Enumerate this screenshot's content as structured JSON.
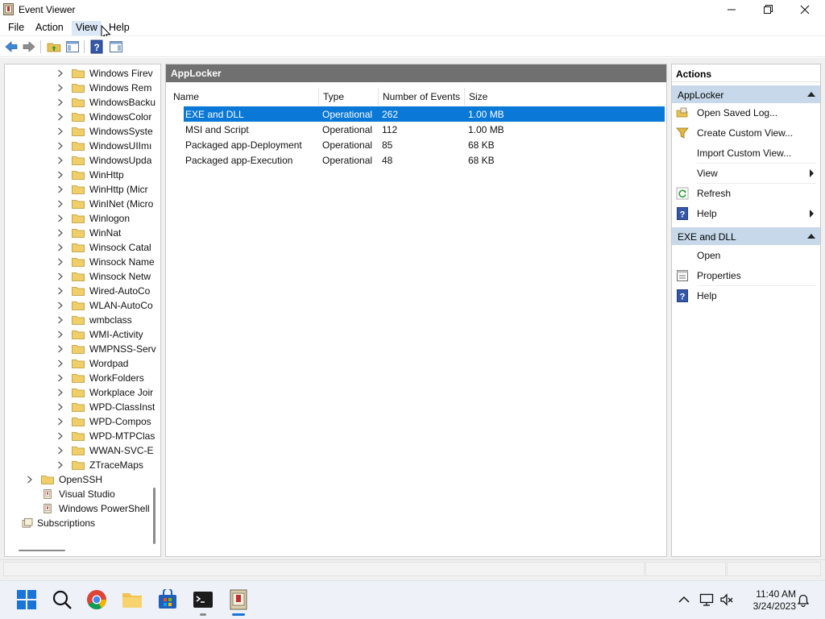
{
  "window": {
    "title": "Event Viewer",
    "icon": "event-viewer-icon"
  },
  "menu": {
    "items": [
      "File",
      "Action",
      "View",
      "Help"
    ],
    "active": "View"
  },
  "toolbar": {
    "buttons": [
      "back-icon",
      "forward-icon",
      "up-folder-icon",
      "show-hide-tree-icon",
      "help-icon",
      "show-hide-action-pane-icon"
    ]
  },
  "tree": {
    "items": [
      "Windows Firev",
      "Windows Rem",
      "WindowsBacku",
      "WindowsColor",
      "WindowsSyste",
      "WindowsUIImı",
      "WindowsUpda",
      "WinHttp",
      "WinHttp (Micr",
      "WinINet (Micro",
      "Winlogon",
      "WinNat",
      "Winsock Catal",
      "Winsock Namе",
      "Winsock Netw",
      "Wired-AutoCo",
      "WLAN-AutoCo",
      "wmbclass",
      "WMI-Activity",
      "WMPNSS-Serv",
      "Wordpad",
      "WorkFolders",
      "Workplace Joir",
      "WPD-ClassInst",
      "WPD-Compos",
      "WPD-MTPClas",
      "WWAN-SVC-E",
      "ZTraceMaps"
    ],
    "root_items": [
      {
        "label": "OpenSSH",
        "expandable": true,
        "icon": "folder-icon"
      },
      {
        "label": "Visual Studio",
        "expandable": false,
        "icon": "log-icon"
      },
      {
        "label": "Windows PowerShell",
        "expandable": false,
        "icon": "log-icon"
      }
    ],
    "subscriptions": "Subscriptions"
  },
  "center": {
    "header": "AppLocker",
    "columns": [
      "Name",
      "Type",
      "Number of Events",
      "Size"
    ],
    "rows": [
      {
        "name": "EXE and DLL",
        "type": "Operational",
        "events": "262",
        "size": "1.00 MB",
        "selected": true
      },
      {
        "name": "MSI and Script",
        "type": "Operational",
        "events": "112",
        "size": "1.00 MB",
        "selected": false
      },
      {
        "name": "Packaged app-Deployment",
        "type": "Operational",
        "events": "85",
        "size": "68 KB",
        "selected": false
      },
      {
        "name": "Packaged app-Execution",
        "type": "Operational",
        "events": "48",
        "size": "68 KB",
        "selected": false
      }
    ]
  },
  "actions": {
    "title": "Actions",
    "section1": {
      "label": "AppLocker",
      "items": [
        {
          "label": "Open Saved Log...",
          "icon": "open-log-icon",
          "submenu": false
        },
        {
          "label": "Create Custom View...",
          "icon": "filter-icon",
          "submenu": false
        },
        {
          "label": "Import Custom View...",
          "icon": "",
          "submenu": false
        },
        {
          "label": "View",
          "icon": "",
          "submenu": true
        },
        {
          "label": "Refresh",
          "icon": "refresh-icon",
          "submenu": false
        },
        {
          "label": "Help",
          "icon": "help-icon",
          "submenu": true
        }
      ]
    },
    "section2": {
      "label": "EXE and DLL",
      "items": [
        {
          "label": "Open",
          "icon": "",
          "submenu": false
        },
        {
          "label": "Properties",
          "icon": "properties-icon",
          "submenu": false
        },
        {
          "label": "Help",
          "icon": "help-icon",
          "submenu": false
        }
      ]
    }
  },
  "taskbar": {
    "apps": [
      "start-icon",
      "search-icon",
      "chrome-icon",
      "file-explorer-icon",
      "store-icon",
      "terminal-icon",
      "event-viewer-icon"
    ],
    "time": "11:40 AM",
    "date": "3/24/2023"
  },
  "colors": {
    "selection": "#0a78d7",
    "section_header": "#c6d8ea",
    "pane_header": "#707070"
  }
}
